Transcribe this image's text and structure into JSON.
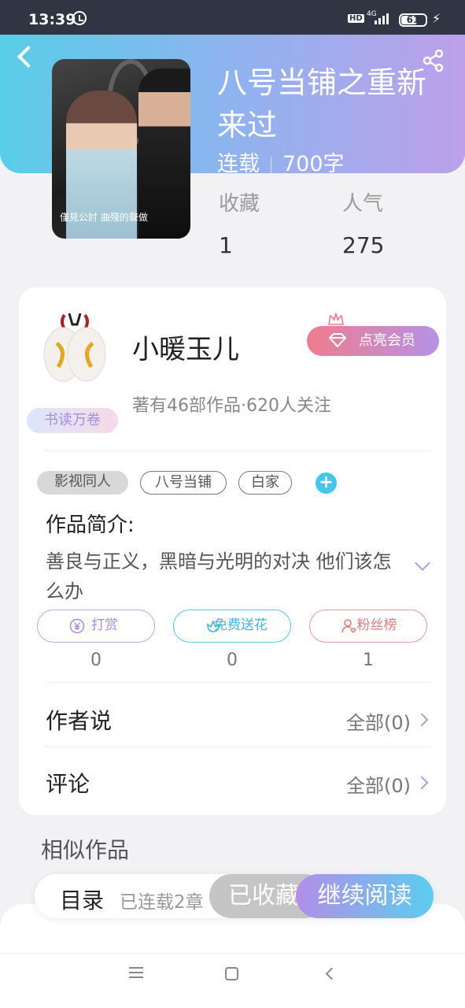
{
  "status_bar": {
    "time": "13:39",
    "hd": "HD",
    "network": "4G",
    "battery": "61"
  },
  "book": {
    "title": "八号当铺之重新来过",
    "state": "连载",
    "words": "700字",
    "cover_caption": "僅見公討 曲殘的聲做",
    "stats": [
      {
        "label": "收藏",
        "value": "1"
      },
      {
        "label": "人气",
        "value": "275"
      }
    ]
  },
  "author": {
    "name": "小暖玉儿",
    "badge": "书读万卷",
    "vip_button": "点亮会员",
    "works_info": "著有46部作品·620人关注"
  },
  "tags": [
    "影视同人",
    "八号当铺",
    "白家"
  ],
  "intro": {
    "heading": "作品简介:",
    "text": "善良与正义，黑暗与光明的对决 他们该怎么办"
  },
  "actions": [
    {
      "label": "打赏",
      "count": "0",
      "icon": "yen-icon"
    },
    {
      "label": "免费送花",
      "count": "0",
      "icon": "flower-icon"
    },
    {
      "label": "粉丝榜",
      "count": "1",
      "icon": "fans-icon"
    }
  ],
  "rows": [
    {
      "label": "作者说",
      "link": "全部(0)"
    },
    {
      "label": "评论",
      "link": "全部(0)"
    }
  ],
  "similar_heading": "相似作品",
  "bottom_bar": {
    "toc": "目录",
    "toc_sub": "已连载2章",
    "collected": "已收藏",
    "read": "继续阅读"
  },
  "colors": {
    "accent_purple": "#b39ae6",
    "accent_blue": "#45c6ec",
    "vip_pink": "#ef7c8e"
  }
}
